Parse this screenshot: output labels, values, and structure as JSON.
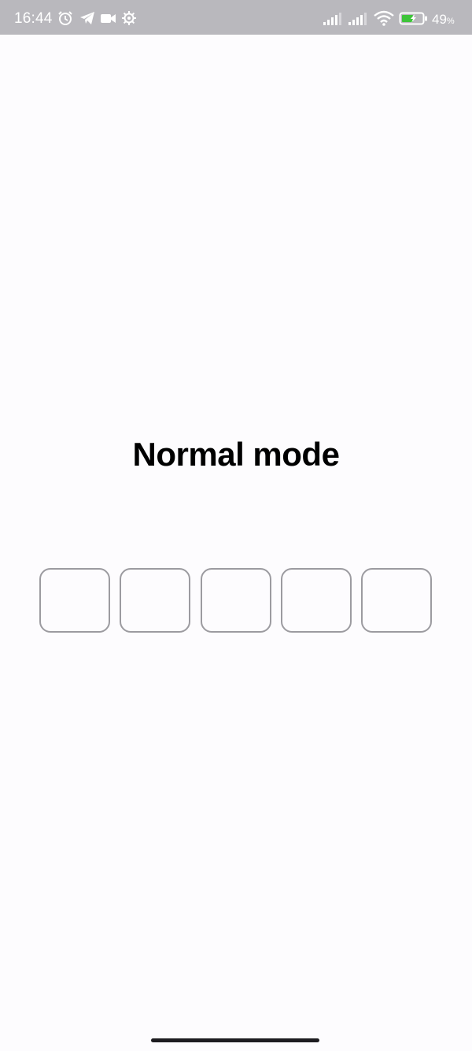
{
  "status_bar": {
    "time": "16:44",
    "battery_value": "49",
    "battery_unit": "%",
    "left_icons": [
      "alarm-icon",
      "telegram-icon",
      "video-camera-icon",
      "settings-gear-icon"
    ],
    "right_icons": [
      "signal-icon",
      "signal-icon",
      "wifi-icon",
      "battery-charging-icon"
    ]
  },
  "main": {
    "title": "Normal mode",
    "otp_boxes": [
      {
        "value": ""
      },
      {
        "value": ""
      },
      {
        "value": ""
      },
      {
        "value": ""
      },
      {
        "value": ""
      }
    ]
  },
  "colors": {
    "status_bar_bg": "#b9b8bd",
    "page_bg": "#fdfcfe",
    "box_border": "#9c9ba0",
    "battery_green": "#3ec43a"
  }
}
